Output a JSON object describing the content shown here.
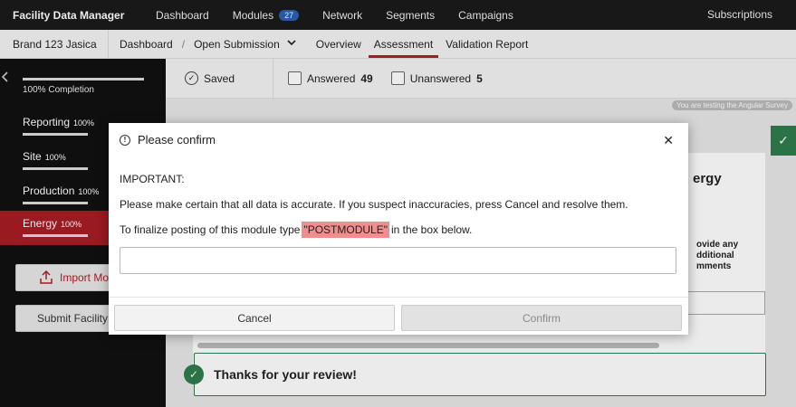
{
  "topnav": {
    "app_title": "Facility Data Manager",
    "items": [
      "Dashboard",
      "Modules",
      "Network",
      "Segments",
      "Campaigns"
    ],
    "modules_badge": "27",
    "right_link": "Subscriptions"
  },
  "subheader": {
    "brand": "Brand 123 Jasica",
    "crumb_dashboard": "Dashboard",
    "crumb_sep": "/",
    "crumb_current": "Open Submission",
    "tabs": [
      "Overview",
      "Assessment",
      "Validation Report"
    ],
    "active_tab": "Assessment"
  },
  "sidebar": {
    "completion": "100% Completion",
    "items": [
      {
        "label": "Reporting",
        "pct": "100%"
      },
      {
        "label": "Site",
        "pct": "100%"
      },
      {
        "label": "Production",
        "pct": "100%"
      },
      {
        "label": "Energy",
        "pct": "100%"
      }
    ],
    "import_label": "Import Mo",
    "submit_label": "Submit Facility"
  },
  "toolbar": {
    "saved": "Saved",
    "answered_label": "Answered",
    "answered_count": "49",
    "unanswered_label": "Unanswered",
    "unanswered_count": "5"
  },
  "main": {
    "testing_tag": "You are testing the Angular Survey",
    "card_title_fragment": "ergy",
    "card_text_fragment": "ovide any\ndditional\nmments",
    "thanks": "Thanks for your review!"
  },
  "modal": {
    "title": "Please confirm",
    "important": "IMPORTANT:",
    "para1": "Please make certain that all data is accurate. If you suspect inaccuracies, press Cancel and resolve them.",
    "para2_before": "To finalize posting of this module type",
    "para2_keyword": "\"POSTMODULE\"",
    "para2_after": "in the box below.",
    "input_value": "",
    "cancel": "Cancel",
    "confirm": "Confirm"
  },
  "colors": {
    "accent_red": "#b01f24",
    "success_green": "#2f7d4e",
    "highlight": "#f08e8e"
  }
}
